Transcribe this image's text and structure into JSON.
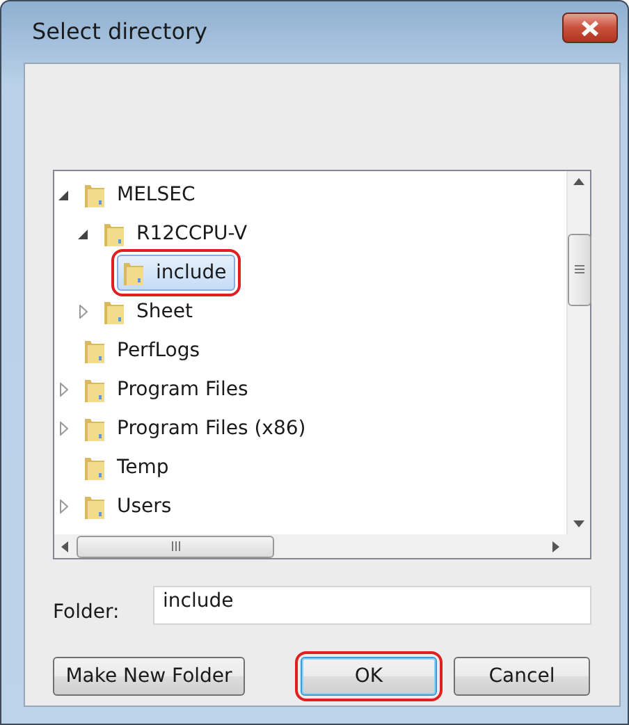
{
  "window": {
    "title": "Select directory"
  },
  "tree": [
    {
      "label": "MELSEC",
      "expandable": true,
      "expanded": true,
      "selected": false,
      "annotated": false,
      "children": [
        {
          "label": "R12CCPU-V",
          "expandable": true,
          "expanded": true,
          "selected": false,
          "annotated": false,
          "children": [
            {
              "label": "include",
              "expandable": false,
              "selected": true,
              "annotated": true
            }
          ]
        },
        {
          "label": "Sheet",
          "expandable": true,
          "expanded": false,
          "selected": false,
          "annotated": false
        }
      ]
    },
    {
      "label": "PerfLogs",
      "expandable": false,
      "selected": false,
      "annotated": false
    },
    {
      "label": "Program Files",
      "expandable": true,
      "expanded": false,
      "selected": false,
      "annotated": false
    },
    {
      "label": "Program Files (x86)",
      "expandable": true,
      "expanded": false,
      "selected": false,
      "annotated": false
    },
    {
      "label": "Temp",
      "expandable": false,
      "selected": false,
      "annotated": false
    },
    {
      "label": "Users",
      "expandable": true,
      "expanded": false,
      "selected": false,
      "annotated": false
    }
  ],
  "folder": {
    "label": "Folder:",
    "value": "include"
  },
  "buttons": [
    {
      "label": "Make New Folder",
      "default": false,
      "annotated": false
    },
    {
      "label": "OK",
      "default": true,
      "annotated": true
    },
    {
      "label": "Cancel",
      "default": false,
      "annotated": false
    }
  ]
}
